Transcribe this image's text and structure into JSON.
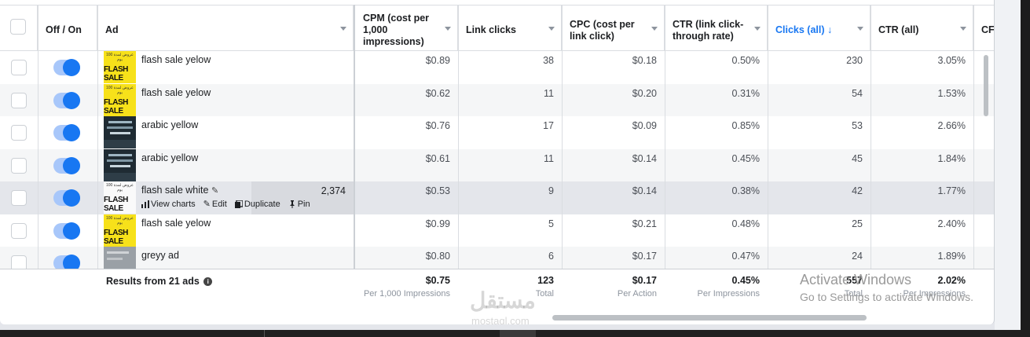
{
  "headers": {
    "off_on": "Off / On",
    "ad": "Ad",
    "cpm": "CPM (cost per 1,000 impressions)",
    "link_clicks": "Link clicks",
    "cpc": "CPC (cost per link click)",
    "ctr_link": "CTR (link click-through rate)",
    "clicks_all": "Clicks (all) ↓",
    "ctr_all": "CTR (all)",
    "cp_partial": "CF"
  },
  "rows": [
    {
      "name": "flash sale yelow",
      "thumb": "yellow",
      "cpm": "$0.89",
      "link_clicks": "38",
      "cpc": "$0.18",
      "ctr_link": "0.50%",
      "clicks_all": "230",
      "ctr_all": "3.05%"
    },
    {
      "name": "flash sale yelow",
      "thumb": "yellow",
      "cpm": "$0.62",
      "link_clicks": "11",
      "cpc": "$0.20",
      "ctr_link": "0.31%",
      "clicks_all": "54",
      "ctr_all": "1.53%"
    },
    {
      "name": "arabic yellow",
      "thumb": "dark",
      "cpm": "$0.76",
      "link_clicks": "17",
      "cpc": "$0.09",
      "ctr_link": "0.85%",
      "clicks_all": "53",
      "ctr_all": "2.66%"
    },
    {
      "name": "arabic yellow",
      "thumb": "dark",
      "cpm": "$0.61",
      "link_clicks": "11",
      "cpc": "$0.14",
      "ctr_link": "0.45%",
      "clicks_all": "45",
      "ctr_all": "1.84%"
    },
    {
      "name": "flash sale white",
      "thumb": "white",
      "hover_value": "2,374",
      "cpm": "$0.53",
      "link_clicks": "9",
      "cpc": "$0.14",
      "ctr_link": "0.38%",
      "clicks_all": "42",
      "ctr_all": "1.77%"
    },
    {
      "name": "flash sale yelow",
      "thumb": "yellow",
      "cpm": "$0.99",
      "link_clicks": "5",
      "cpc": "$0.21",
      "ctr_link": "0.48%",
      "clicks_all": "25",
      "ctr_all": "2.40%"
    },
    {
      "name": "greyy ad",
      "thumb": "grey",
      "cpm": "$0.80",
      "link_clicks": "6",
      "cpc": "$0.17",
      "ctr_link": "0.47%",
      "clicks_all": "24",
      "ctr_all": "1.89%"
    }
  ],
  "thumb_text": {
    "small": "عروض لمدة 100 يوم",
    "flash": "FLASH SALE"
  },
  "hover_actions": {
    "view_charts": "View charts",
    "edit": "Edit",
    "duplicate": "Duplicate",
    "pin": "Pin"
  },
  "footer": {
    "label": "Results from 21 ads",
    "cpm": {
      "value": "$0.75",
      "sub": "Per 1,000 Impressions"
    },
    "link_clicks": {
      "value": "123",
      "sub": "Total"
    },
    "cpc": {
      "value": "$0.17",
      "sub": "Per Action"
    },
    "ctr_link": {
      "value": "0.45%",
      "sub": "Per Impressions"
    },
    "clicks_all": {
      "value": "557",
      "sub": "Total"
    },
    "ctr_all": {
      "value": "2.02%",
      "sub": "Per Impressions"
    }
  },
  "watermark": {
    "line1": "Activate Windows",
    "line2": "Go to Settings to activate Windows.",
    "brand": "مستقل",
    "brand_latin": "mostaql.com"
  },
  "colors": {
    "accent": "#1877f2",
    "highlight_yellow": "#f7e11a"
  }
}
